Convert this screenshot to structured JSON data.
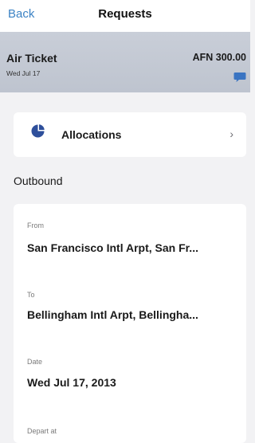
{
  "nav": {
    "back_label": "Back",
    "title": "Requests"
  },
  "summary": {
    "title": "Air Ticket",
    "date": "Wed Jul 17",
    "amount": "AFN 300.00",
    "icon": "comment-icon",
    "icon_color": "#3a74c2"
  },
  "allocations": {
    "label": "Allocations",
    "icon": "pie-chart-icon",
    "icon_color": "#2e4f9b"
  },
  "outbound": {
    "section_title": "Outbound",
    "fields": [
      {
        "label": "From",
        "value": "San Francisco Intl Arpt, San Fr..."
      },
      {
        "label": "To",
        "value": "Bellingham Intl Arpt, Bellingha..."
      },
      {
        "label": "Date",
        "value": "Wed Jul 17, 2013"
      },
      {
        "label": "Depart at",
        "value": ""
      }
    ]
  }
}
